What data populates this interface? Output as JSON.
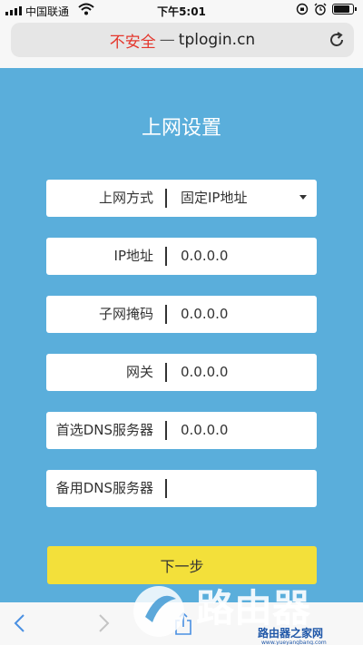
{
  "status_bar": {
    "carrier": "中国联通",
    "time": "下午5:01",
    "icons": [
      "signal-icon",
      "wifi-icon",
      "orientation-lock-icon",
      "alarm-icon",
      "battery-icon"
    ]
  },
  "browser": {
    "insecure_label": "不安全",
    "separator": "—",
    "domain": "tplogin.cn",
    "reload_icon": "reload-icon"
  },
  "page": {
    "background_color": "#5aaedb",
    "title": "上网设置",
    "fields": [
      {
        "label": "上网方式",
        "value": "固定IP地址",
        "type": "select"
      },
      {
        "label": "IP地址",
        "value": "0.0.0.0",
        "type": "input"
      },
      {
        "label": "子网掩码",
        "value": "0.0.0.0",
        "type": "input"
      },
      {
        "label": "网关",
        "value": "0.0.0.0",
        "type": "input"
      },
      {
        "label": "首选DNS服务器",
        "value": "0.0.0.0",
        "type": "input"
      },
      {
        "label": "备用DNS服务器",
        "value": "",
        "type": "input"
      }
    ],
    "next_button": "下一步",
    "next_button_color": "#f3e03a"
  },
  "toolbar": {
    "icons": [
      "back-icon",
      "forward-icon",
      "share-icon"
    ]
  },
  "watermark": {
    "site_text": "路由器",
    "secondary_text": "路由器之家网",
    "url": "www.yueyangbang.com"
  }
}
